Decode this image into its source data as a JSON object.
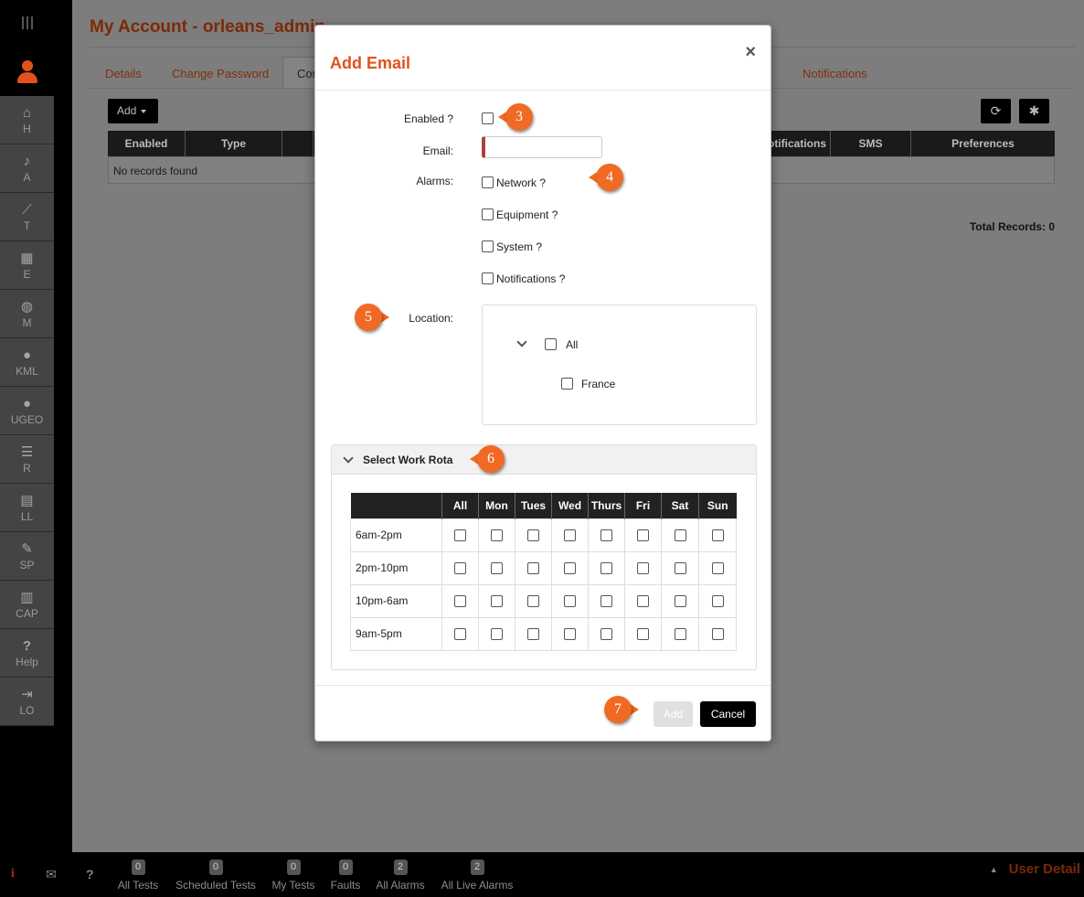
{
  "page": {
    "title": "My Account - orleans_admin",
    "tabs": [
      "Details",
      "Change Password",
      "Cor",
      "Notifications"
    ],
    "add_label": "Add",
    "table_headers": [
      "Enabled",
      "Type",
      "otifications",
      "SMS",
      "Preferences"
    ],
    "empty_text": "No records found",
    "total_records": "Total Records: 0"
  },
  "sidebar": {
    "items": [
      {
        "label": "H",
        "icon": "home-icon",
        "glyph": "⌂"
      },
      {
        "label": "A",
        "icon": "bell-icon",
        "glyph": "♪"
      },
      {
        "label": "T",
        "icon": "trend-chart-icon",
        "glyph": "⟋"
      },
      {
        "label": "E",
        "icon": "chip-icon",
        "glyph": "▦"
      },
      {
        "label": "M",
        "icon": "globe-icon",
        "glyph": "◍"
      },
      {
        "label": "KML",
        "icon": "map-pin-icon",
        "glyph": "●"
      },
      {
        "label": "UGEO",
        "icon": "map-pin-icon",
        "glyph": "●"
      },
      {
        "label": "R",
        "icon": "list-icon",
        "glyph": "☰"
      },
      {
        "label": "LL",
        "icon": "book-icon",
        "glyph": "▤"
      },
      {
        "label": "SP",
        "icon": "wrench-icon",
        "glyph": "✎"
      },
      {
        "label": "CAP",
        "icon": "server-icon",
        "glyph": "▥"
      },
      {
        "label": "Help",
        "icon": "question-icon",
        "glyph": "?"
      },
      {
        "label": "LO",
        "icon": "logout-icon",
        "glyph": "⇥"
      }
    ]
  },
  "modal": {
    "title": "Add Email",
    "close_glyph": "×",
    "enabled_label": "Enabled ?",
    "email_label": "Email:",
    "alarms_label": "Alarms:",
    "alarms": [
      "Network ?",
      "Equipment ?",
      "System ?",
      "Notifications ?"
    ],
    "location_label": "Location:",
    "locations": {
      "root": "All",
      "child": "France"
    },
    "rota_title": "Select Work Rota",
    "rota_columns": [
      "All",
      "Mon",
      "Tues",
      "Wed",
      "Thurs",
      "Fri",
      "Sat",
      "Sun"
    ],
    "rota_rows": [
      "6am-2pm",
      "2pm-10pm",
      "10pm-6am",
      "9am-5pm"
    ],
    "add_button": "Add",
    "cancel_button": "Cancel"
  },
  "callouts": [
    "3",
    "4",
    "5",
    "6",
    "7"
  ],
  "bottombar": {
    "stats": [
      {
        "count": "0",
        "label": "All Tests"
      },
      {
        "count": "0",
        "label": "Scheduled Tests"
      },
      {
        "count": "0",
        "label": "My Tests"
      },
      {
        "count": "0",
        "label": "Faults"
      },
      {
        "count": "2",
        "label": "All Alarms"
      },
      {
        "count": "2",
        "label": "All Live Alarms"
      }
    ],
    "user_detail": "User Detail",
    "icons": {
      "info": "i",
      "mail": "✉",
      "help": "?",
      "up": "▲"
    }
  },
  "colors": {
    "accent": "#e2511a",
    "callout": "#f06a24",
    "brand_dark": "#7a2a07"
  }
}
